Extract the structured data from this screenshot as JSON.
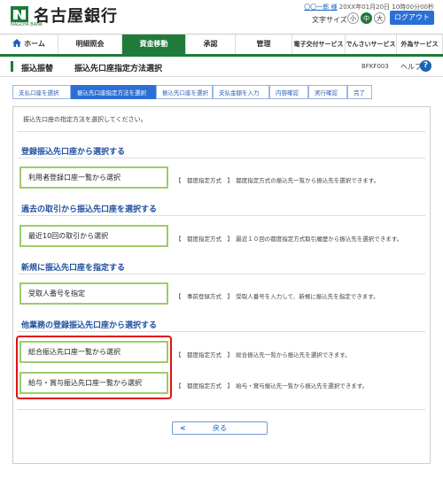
{
  "header": {
    "bank_name": "名古屋銀行",
    "bank_sub": "NAGOYA BANK",
    "user_name": "〇〇一郎 様",
    "datetime": "20XX年01月20日 10時00分00秒",
    "font_size_label": "文字サイズ",
    "font_small": "小",
    "font_medium": "中",
    "font_large": "大",
    "logout": "ログアウト"
  },
  "nav": {
    "items": [
      {
        "label": "ホーム"
      },
      {
        "label": "明細照会"
      },
      {
        "label": "資金移動"
      },
      {
        "label": "承認"
      },
      {
        "label": "管理"
      },
      {
        "label": "電子交付サービス"
      },
      {
        "label": "でんさいサービス"
      },
      {
        "label": "外為サービス"
      }
    ],
    "active_index": 2
  },
  "page": {
    "category": "振込振替",
    "title": "振込先口座指定方法選択",
    "code": "BFKF003",
    "help": "ヘルプ"
  },
  "steps": [
    {
      "label": "支払口座を選択"
    },
    {
      "label": "振込先口座指定方法を選択"
    },
    {
      "label": "振込先口座を選択"
    },
    {
      "label": "支払金額を入力"
    },
    {
      "label": "内容確認"
    },
    {
      "label": "実行確認"
    },
    {
      "label": "完了"
    }
  ],
  "instruction": "振込先口座の指定方法を選択してください。",
  "sections": [
    {
      "title": "登録振込先口座から選択する",
      "options": [
        {
          "label": "利用者登録口座一覧から選択",
          "desc": "【　都度指定方式　】　都度指定方式の振込先一覧から振込先を選択できます。"
        }
      ]
    },
    {
      "title": "過去の取引から振込先口座を選択する",
      "options": [
        {
          "label": "最近10回の取引から選択",
          "desc": "【　都度指定方式　】　最近１０回の都度指定方式取引履歴から振込先を選択できます。"
        }
      ]
    },
    {
      "title": "新規に振込先口座を指定する",
      "options": [
        {
          "label": "受取人番号を指定",
          "desc": "【　事前登録方式　】　受取人番号を入力して、新規に振込先を指定できます。"
        }
      ]
    },
    {
      "title": "他業務の登録振込先口座から選択する",
      "options": [
        {
          "label": "総合振込先口座一覧から選択",
          "desc": "【　都度指定方式　】　総合振込先一覧から振込先を選択できます。"
        },
        {
          "label": "給与・賞与振込先口座一覧から選択",
          "desc": "【　都度指定方式　】　給与・賞与振込先一覧から振込先を選択できます。"
        }
      ]
    }
  ],
  "back_label": "戻る",
  "colors": {
    "brand_green": "#1e7b3a",
    "link_blue": "#2b6fd6",
    "option_border": "#9ccc6b",
    "highlight_red": "#e01010"
  }
}
